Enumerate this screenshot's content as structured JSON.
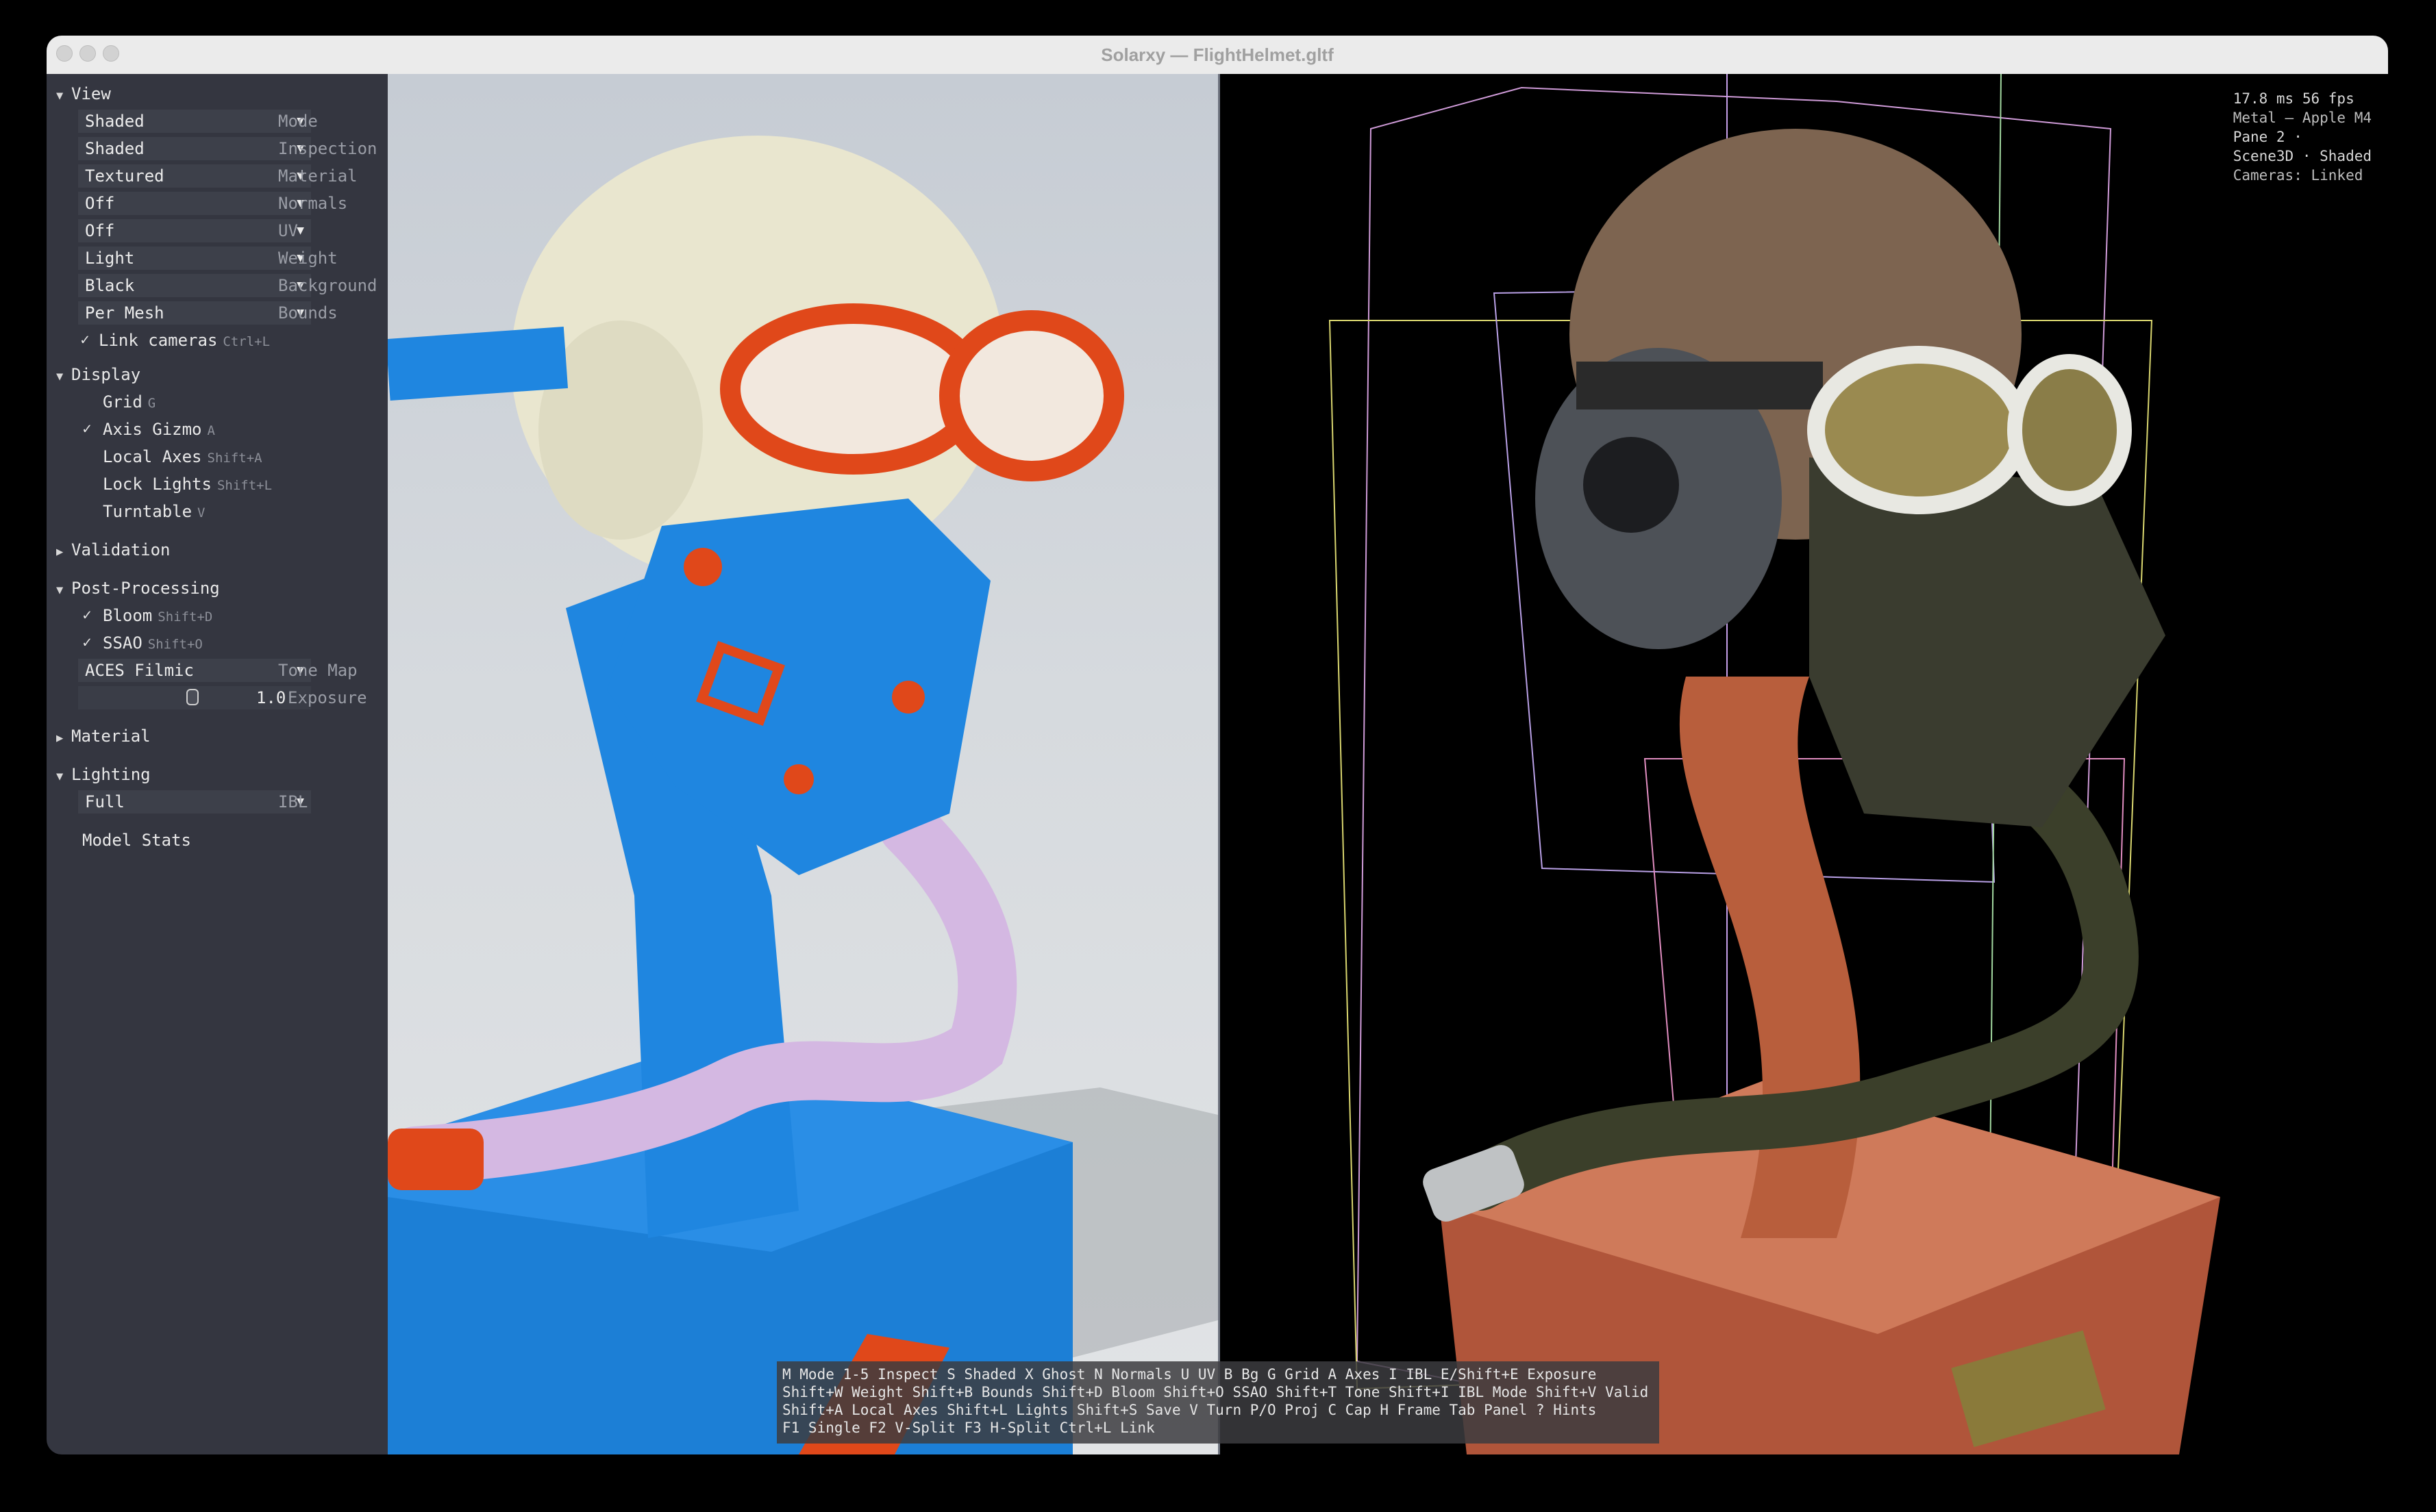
{
  "window": {
    "title": "Solarxy — FlightHelmet.gltf"
  },
  "panel": {
    "view": {
      "header": "View",
      "combos": [
        {
          "value": "Shaded",
          "label": "Mode"
        },
        {
          "value": "Shaded",
          "label": "Inspection"
        },
        {
          "value": "Textured",
          "label": "Material"
        },
        {
          "value": "Off",
          "label": "Normals"
        },
        {
          "value": "Off",
          "label": "UV"
        },
        {
          "value": "Light",
          "label": "Weight"
        },
        {
          "value": "Black",
          "label": "Background"
        },
        {
          "value": "Per Mesh",
          "label": "Bounds"
        }
      ],
      "link_cameras": {
        "label": "Link cameras",
        "shortcut": "Ctrl+L",
        "checked": true
      }
    },
    "display": {
      "header": "Display",
      "items": [
        {
          "label": "Grid",
          "shortcut": "G",
          "checked": false
        },
        {
          "label": "Axis Gizmo",
          "shortcut": "A",
          "checked": true
        },
        {
          "label": "Local Axes",
          "shortcut": "Shift+A",
          "checked": false
        },
        {
          "label": "Lock Lights",
          "shortcut": "Shift+L",
          "checked": false
        },
        {
          "label": "Turntable",
          "shortcut": "V",
          "checked": false
        }
      ]
    },
    "validation": {
      "header": "Validation"
    },
    "post": {
      "header": "Post-Processing",
      "items": [
        {
          "label": "Bloom",
          "shortcut": "Shift+D",
          "checked": true
        },
        {
          "label": "SSAO",
          "shortcut": "Shift+O",
          "checked": true
        }
      ],
      "tonemap": {
        "value": "ACES Filmic",
        "label": "Tone Map"
      },
      "exposure": {
        "value": "1.0",
        "label": "Exposure"
      }
    },
    "material": {
      "header": "Material"
    },
    "lighting": {
      "header": "Lighting",
      "ibl": {
        "value": "Full",
        "label": "IBL"
      }
    },
    "model_stats": {
      "header": "Model Stats"
    }
  },
  "stats": {
    "line1": "17.8 ms  56 fps",
    "line2": "Metal — Apple M4",
    "line3": "Pane 2 ·",
    "line4": "Scene3D · Shaded",
    "line5": "Cameras: Linked"
  },
  "hints": {
    "line1": "M Mode  1-5 Inspect  S Shaded  X Ghost  N Normals  U UV  B Bg  G Grid  A Axes  I IBL  E/Shift+E Exposure",
    "line2": "Shift+W Weight  Shift+B Bounds  Shift+D Bloom  Shift+O SSAO  Shift+T Tone  Shift+I IBL Mode  Shift+V Valid",
    "line3": "Shift+A Local Axes  Shift+L Lights  Shift+S Save  V Turn  P/O Proj  C Cap  H Frame  Tab Panel  ? Hints",
    "line4": "F1 Single  F2 V-Split  F3 H-Split  Ctrl+L Link"
  },
  "colors": {
    "panel_bg": "#343640",
    "viewport_left_bg": "#d2d6da",
    "viewport_right_bg": "#000000",
    "mesh_blue": "#1f86e0",
    "mesh_orange": "#e0481a",
    "mesh_cream": "#e9e6cf",
    "hose_lilac": "#d4b8e2"
  }
}
